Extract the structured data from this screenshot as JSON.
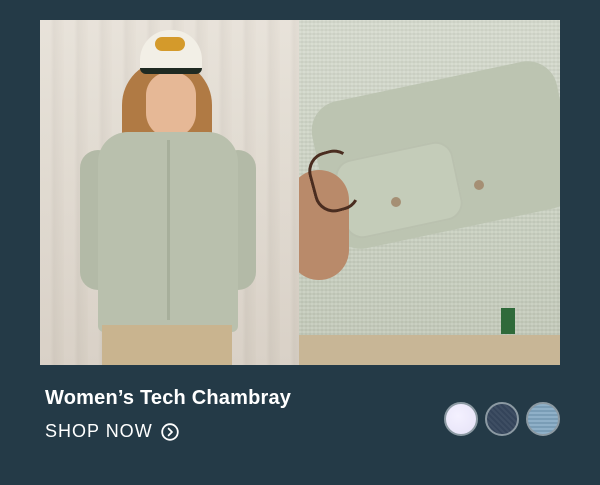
{
  "product": {
    "title": "Women’s Tech Chambray",
    "cta_label": "SHOP NOW"
  },
  "images": {
    "left": "model-wearing-chambray-shirt-and-cap",
    "right": "sleeve-cuff-closeup"
  },
  "icons": {
    "cta": "arrow-right-circle-icon"
  },
  "swatches": [
    {
      "name": "white",
      "color": "#ECE9FF"
    },
    {
      "name": "navy",
      "color": "#3A4A60"
    },
    {
      "name": "light-chambray",
      "color": "#86A7BF"
    }
  ],
  "colors": {
    "background": "#243A47",
    "text": "#FFFFFF"
  }
}
